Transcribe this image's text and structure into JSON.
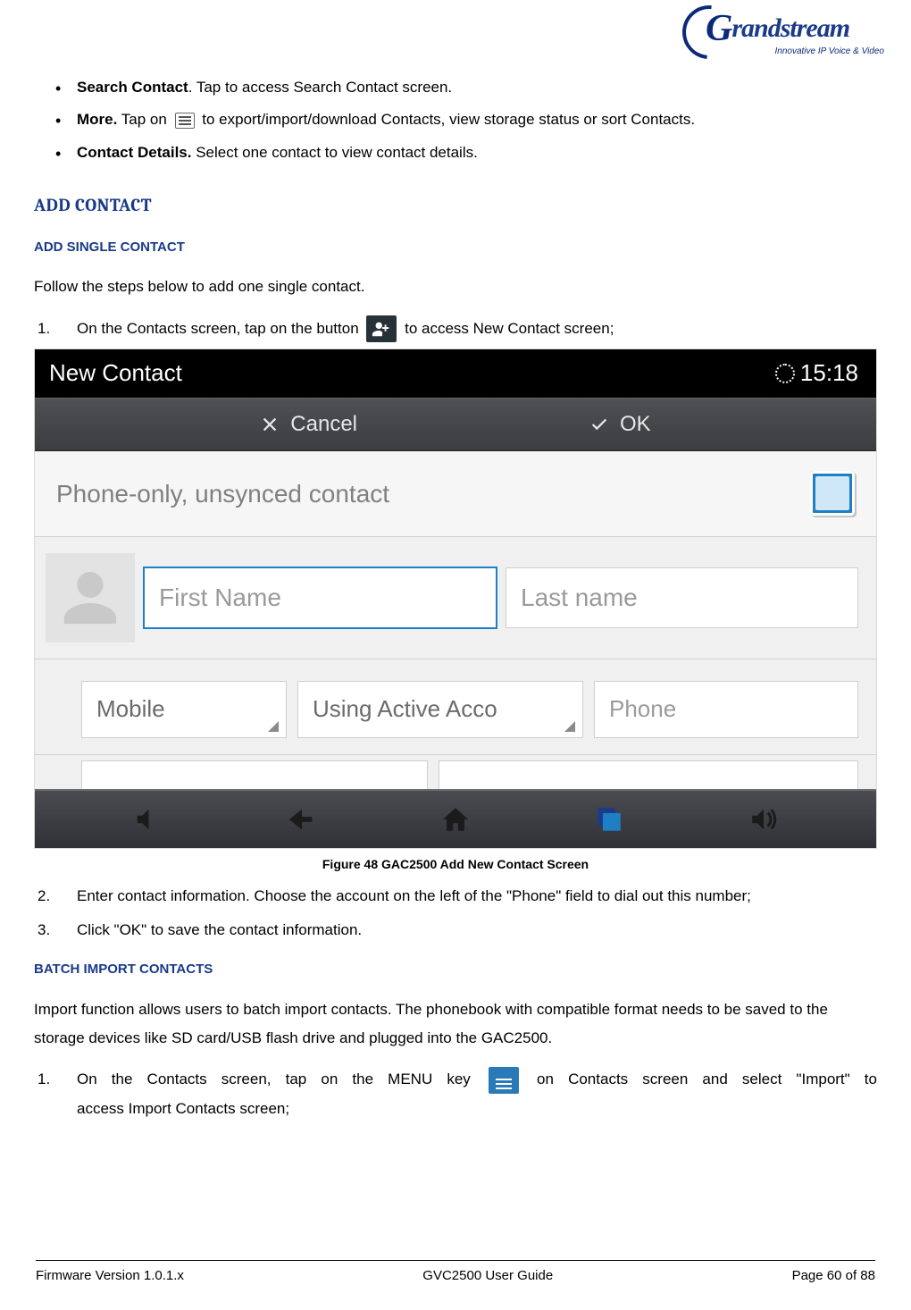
{
  "brand": {
    "name": "Grandstream",
    "tagline": "Innovative IP Voice & Video"
  },
  "bullets": [
    {
      "bold": "Search Contact",
      "rest": ". Tap to access Search Contact screen."
    },
    {
      "bold": "More.",
      "rest": " Tap on  to export/import/download Contacts, view storage status or sort Contacts.",
      "before_icon": " Tap on ",
      "after_icon": " to export/import/download Contacts, view storage status or sort Contacts."
    },
    {
      "bold": "Contact Details.",
      "rest": " Select one contact to view contact details."
    }
  ],
  "h2_add_contact": "ADD CONTACT",
  "h3_add_single": "ADD SINGLE CONTACT",
  "intro_single": "Follow the steps below to add one single contact.",
  "steps_single": {
    "s1_before": "On the Contacts screen, tap on the button ",
    "s1_after": " to access New Contact screen;",
    "s2": "Enter contact information. Choose the account on the left of the \"Phone\" field to dial out this number;",
    "s3": "Click \"OK\" to save the contact information."
  },
  "figure": {
    "title": "New Contact",
    "time": "15:18",
    "cancel": "Cancel",
    "ok": "OK",
    "sync_label": "Phone-only, unsynced contact",
    "first_name": "First Name",
    "last_name": "Last name",
    "mobile": "Mobile",
    "account": "Using Active Acco",
    "phone": "Phone",
    "caption": "Figure 48 GAC2500 Add New Contact Screen"
  },
  "h3_batch": "BATCH IMPORT CONTACTS",
  "batch_intro": "Import function allows users to batch import contacts. The phonebook with compatible format needs to be saved to the storage devices like SD card/USB flash drive and plugged into the GAC2500.",
  "steps_batch": {
    "s1_before": "On the Contacts screen, tap on the MENU key ",
    "s1_after": " on Contacts screen and select \"Import\" to",
    "s1_line2": "access Import Contacts screen;"
  },
  "footer": {
    "left": "Firmware Version 1.0.1.x",
    "center": "GVC2500 User Guide",
    "right": "Page 60 of 88"
  }
}
